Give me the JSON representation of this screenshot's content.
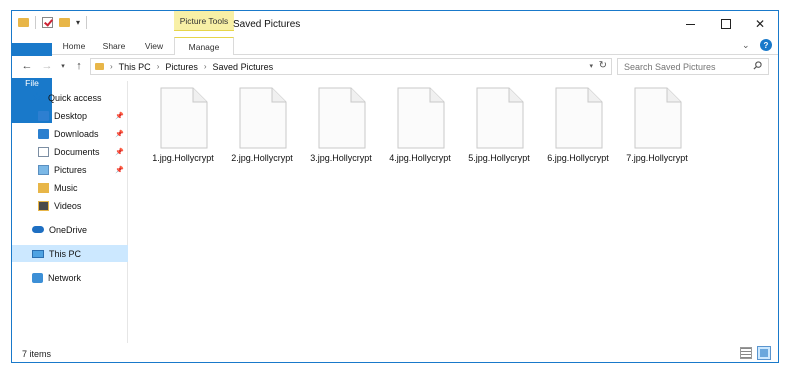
{
  "window": {
    "title": "Saved Pictures"
  },
  "titlebar": {
    "context_tab_group": "Picture Tools"
  },
  "ribbon": {
    "tabs": [
      {
        "label": "File"
      },
      {
        "label": "Home"
      },
      {
        "label": "Share"
      },
      {
        "label": "View"
      },
      {
        "label": "Manage"
      }
    ],
    "help_label": "?"
  },
  "address": {
    "breadcrumbs": [
      "This PC",
      "Pictures",
      "Saved Pictures"
    ]
  },
  "search": {
    "placeholder": "Search Saved Pictures"
  },
  "sidebar": {
    "items": [
      {
        "label": "Quick access",
        "icon": "star-icon"
      },
      {
        "label": "Desktop",
        "icon": "desktop-icon",
        "pinned": true
      },
      {
        "label": "Downloads",
        "icon": "downloads-icon",
        "pinned": true
      },
      {
        "label": "Documents",
        "icon": "documents-icon",
        "pinned": true
      },
      {
        "label": "Pictures",
        "icon": "pictures-icon",
        "pinned": true
      },
      {
        "label": "Music",
        "icon": "music-icon"
      },
      {
        "label": "Videos",
        "icon": "videos-icon"
      },
      {
        "label": "OneDrive",
        "icon": "cloud-icon"
      },
      {
        "label": "This PC",
        "icon": "computer-icon",
        "selected": true
      },
      {
        "label": "Network",
        "icon": "network-icon"
      }
    ]
  },
  "files": [
    {
      "name": "1.jpg.Hollycrypt"
    },
    {
      "name": "2.jpg.Hollycrypt"
    },
    {
      "name": "3.jpg.Hollycrypt"
    },
    {
      "name": "4.jpg.Hollycrypt"
    },
    {
      "name": "5.jpg.Hollycrypt"
    },
    {
      "name": "6.jpg.Hollycrypt"
    },
    {
      "name": "7.jpg.Hollycrypt"
    }
  ],
  "status": {
    "item_count": "7 items"
  },
  "colors": {
    "accent": "#1979ca",
    "context_tab": "#f8f0a6",
    "selection": "#cce8ff"
  }
}
